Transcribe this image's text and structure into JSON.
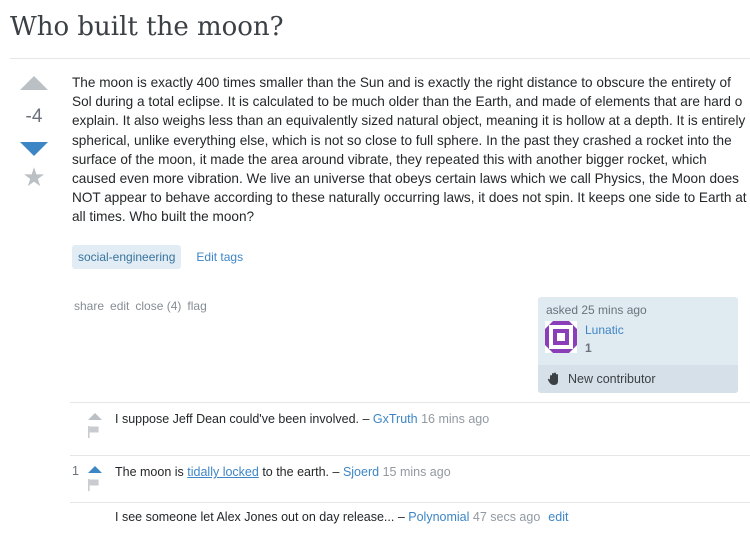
{
  "question": {
    "title": "Who built the moon?",
    "score": "-4",
    "body": "The moon is exactly 400 times smaller than the Sun and is exactly the right distance to obscure the entirety of Sol during a total eclipse. It is calculated to be much older than the Earth, and made of elements that are hard o explain. It also weighs less than an equivalently sized natural object, meaning it is hollow at a depth. It is entirely spherical, unlike everything else, which is not so close to full sphere. In the past they crashed a rocket into the surface of the moon, it made the area around vibrate, they repeated this with another bigger rocket, which caused even more vibration. We live an universe that obeys certain laws which we call Physics, the Moon does NOT appear to behave according to these naturally occurring laws, it does not spin. It keeps one side to Earth at all times. Who built the moon?",
    "tags": [
      "social-engineering"
    ],
    "edit_tags": "Edit tags"
  },
  "post_menu": {
    "share": "share",
    "edit": "edit",
    "close": "close (4)",
    "flag": "flag"
  },
  "owner": {
    "asked": "asked 25 mins ago",
    "name": "Lunatic",
    "reputation": "1",
    "new_contributor": "New contributor"
  },
  "comments": [
    {
      "score": "",
      "text": "I suppose Jeff Dean could've been involved.",
      "sep": " – ",
      "user": "GxTruth",
      "time": "16 mins ago"
    },
    {
      "score": "1",
      "text_before": "The moon is ",
      "link": "tidally locked",
      "text_after": " to the earth.",
      "sep": " – ",
      "user": "Sjoerd",
      "time": "15 mins ago"
    },
    {
      "text": "I see someone let Alex Jones out on day release...",
      "sep": " – ",
      "user": "Polynomial",
      "time": "47 secs ago",
      "edit": "edit"
    }
  ],
  "icons": {
    "upvote": "up-arrow-icon",
    "downvote": "down-arrow-icon",
    "favorite": "star-icon",
    "flag": "flag-icon",
    "wave": "wave-hand-icon"
  },
  "colors": {
    "link": "#3d86c6",
    "tag_bg": "#e1ecf4",
    "tag_fg": "#39739d",
    "owner_bg": "#e0eaf1"
  }
}
